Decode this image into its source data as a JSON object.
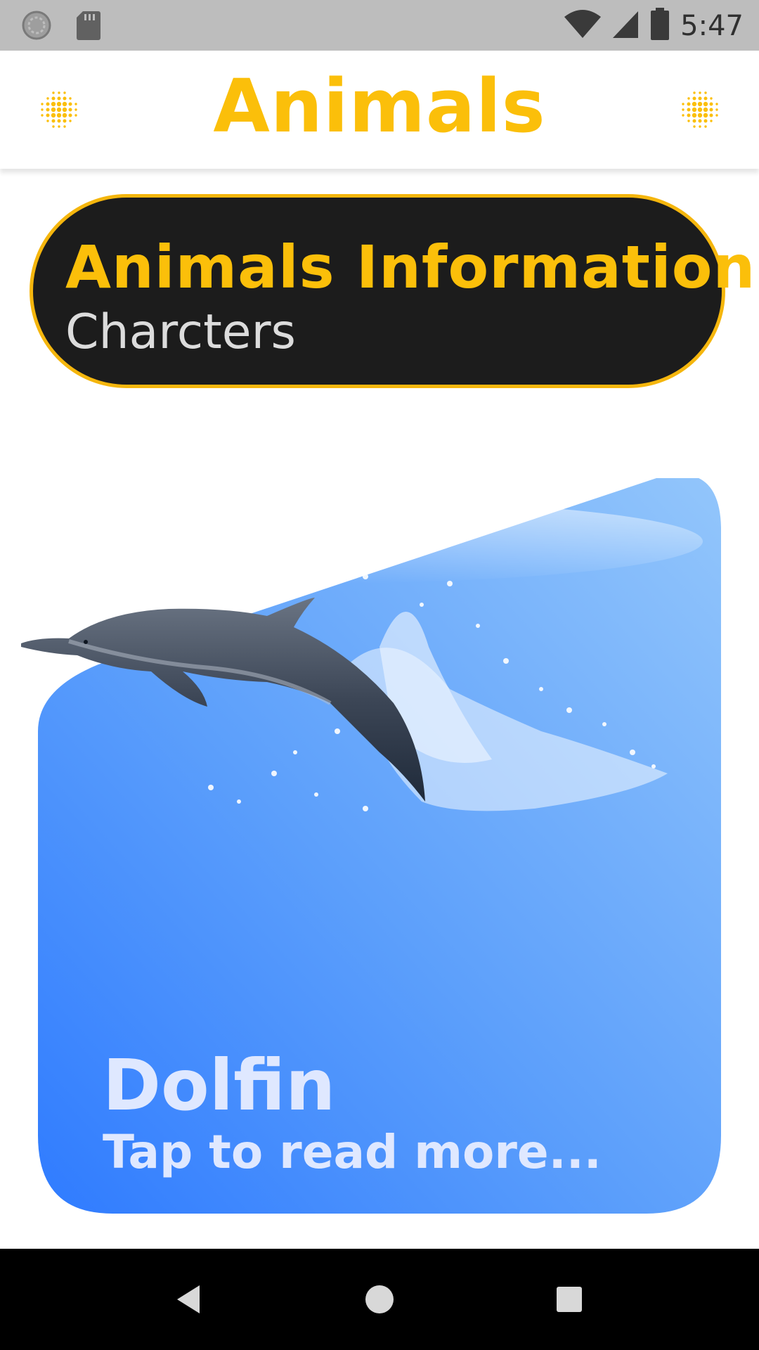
{
  "status_bar": {
    "time": "5:47",
    "icons": [
      "sync-icon",
      "sd-card-icon",
      "wifi-icon",
      "cell-signal-icon",
      "battery-icon"
    ]
  },
  "app_bar": {
    "title": "Animals",
    "left_icon": "dots-pattern-icon",
    "right_icon": "dots-pattern-icon"
  },
  "info_banner": {
    "title": "Animals Information",
    "subtitle": "Charcters"
  },
  "card": {
    "title": "Dolfin",
    "subtitle": "Tap to read more...",
    "image": "dolphin-jumping-from-water"
  },
  "nav_bar": {
    "buttons": [
      "back-icon",
      "home-icon",
      "recents-icon"
    ]
  },
  "colors": {
    "accent": "#FBBF0A",
    "banner_bg": "#1C1C1C",
    "card_gradient_top": "#8EC5FC",
    "card_gradient_bottom": "#2F7BFF",
    "status_bar": "#BDBDBD",
    "nav_bar": "#000000"
  }
}
